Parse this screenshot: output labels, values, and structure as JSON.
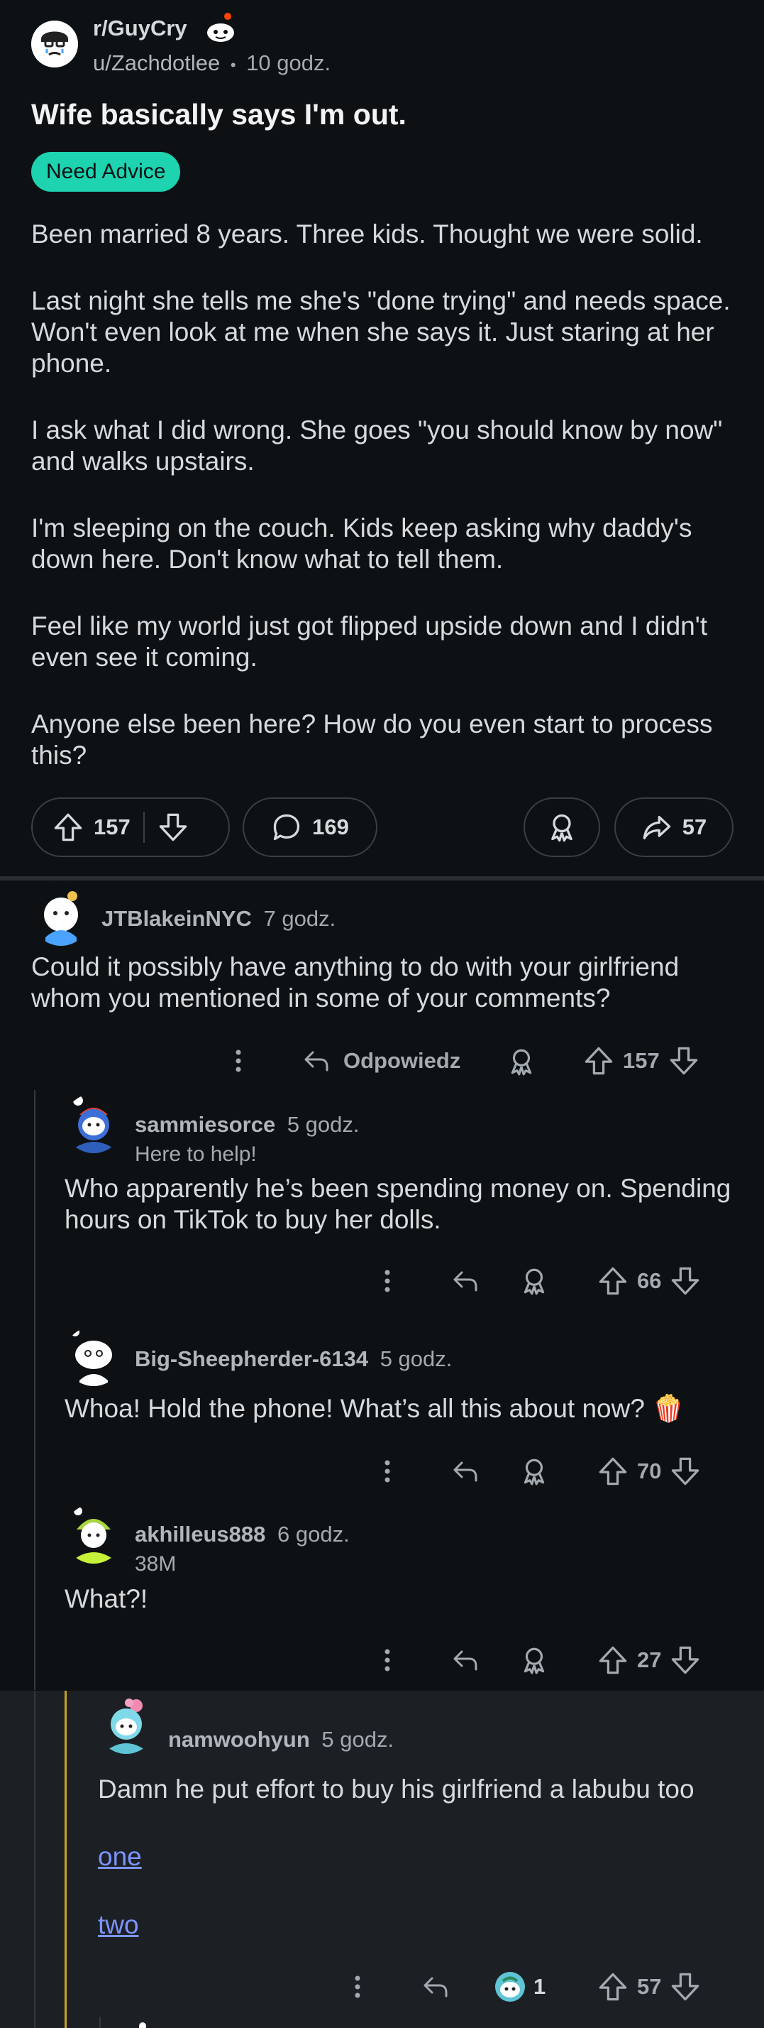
{
  "post": {
    "subreddit": "r/GuyCry",
    "author": "u/Zachdotlee",
    "separator": "•",
    "time": "10 godz.",
    "title": "Wife basically says I'm out.",
    "flair": "Need Advice",
    "paragraphs": [
      "Been married 8 years. Three kids. Thought we were solid.",
      "Last night she tells me she's \"done trying\" and needs space. Won't even look at me when she says it. Just staring at her phone.",
      "I ask what I did wrong. She goes \"you should know by now\" and walks upstairs.",
      "I'm sleeping on the couch. Kids keep asking why daddy's down here. Don't know what to tell them.",
      "Feel like my world just got flipped upside down and I didn't even see it coming.",
      "Anyone else been here? How do you even start to process this?"
    ],
    "votes": "157",
    "comments": "169",
    "shares": "57"
  },
  "comments": [
    {
      "user": "JTBlakeinNYC",
      "time": "7 godz.",
      "text": "Could it possibly have anything to do with your girlfriend whom you mentioned in some of your comments?",
      "reply_label": "Odpowiedz",
      "votes": "157"
    },
    {
      "user": "sammiesorce",
      "time": "5 godz.",
      "flair": "Here to help!",
      "text": "Who apparently he’s been spending money on. Spending hours on TikTok to buy her dolls.",
      "votes": "66"
    },
    {
      "user": "Big-Sheepherder-6134",
      "time": "5 godz.",
      "text": "Whoa! Hold the phone! What’s all this about now?",
      "emoji": "🍿",
      "votes": "70"
    },
    {
      "user": "akhilleus888",
      "time": "6 godz.",
      "flair": "38M",
      "text": "What?!",
      "votes": "27"
    },
    {
      "user": "namwoohyun",
      "time": "5 godz.",
      "text": "Damn he put effort to buy his girlfriend a labubu too",
      "link1": "one",
      "link2": "two",
      "award_count": "1",
      "votes": "57"
    }
  ],
  "icons": [
    "upvote-icon",
    "downvote-icon",
    "comment-icon",
    "award-icon",
    "share-icon",
    "more-icon",
    "reply-icon"
  ],
  "colors": {
    "background": "#0e1113",
    "highlight_bg": "#1c2024",
    "flair": "#1dd3b0",
    "link": "#7b94ff",
    "thread_highlight": "#c9a227"
  }
}
